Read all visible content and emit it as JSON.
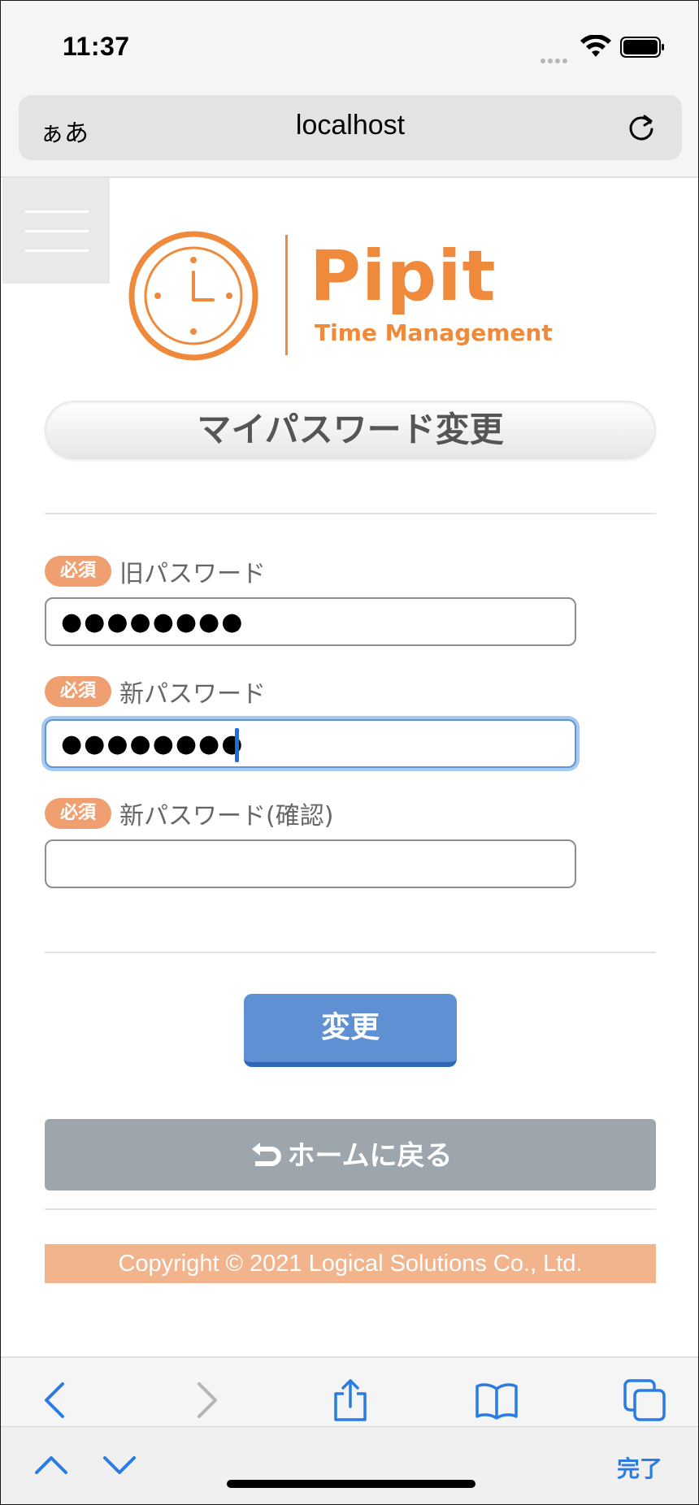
{
  "status": {
    "time": "11:37"
  },
  "browser": {
    "text_size_label": "ぁあ",
    "url": "localhost"
  },
  "logo": {
    "name": "Pipit",
    "tagline": "Time Management"
  },
  "page": {
    "title": "マイパスワード変更"
  },
  "form": {
    "required_badge": "必須",
    "fields": [
      {
        "label": "旧パスワード",
        "value": "●●●●●●●●"
      },
      {
        "label": "新パスワード",
        "value": "●●●●●●●●"
      },
      {
        "label": "新パスワード(確認)",
        "value": ""
      }
    ],
    "submit_label": "変更"
  },
  "nav": {
    "home_label": "ホームに戻る"
  },
  "footer": {
    "copyright": "Copyright © 2021 Logical Solutions Co., Ltd."
  },
  "keyboard_bar": {
    "done_label": "完了"
  },
  "colors": {
    "brand_orange": "#ef8a3c",
    "required_badge": "#f0a070",
    "submit_button": "#5f90d4",
    "home_button": "#9ea6ad",
    "focus_ring": "#a8c8f0",
    "ios_blue": "#2a7be4"
  },
  "icons": {
    "status": [
      "wifi-icon",
      "battery-icon"
    ],
    "browser": [
      "reload-icon"
    ],
    "toolbar": [
      "back-icon",
      "forward-icon",
      "share-icon",
      "bookmarks-icon",
      "tabs-icon"
    ],
    "keyboard_bar": [
      "chevron-up-icon",
      "chevron-down-icon"
    ]
  }
}
